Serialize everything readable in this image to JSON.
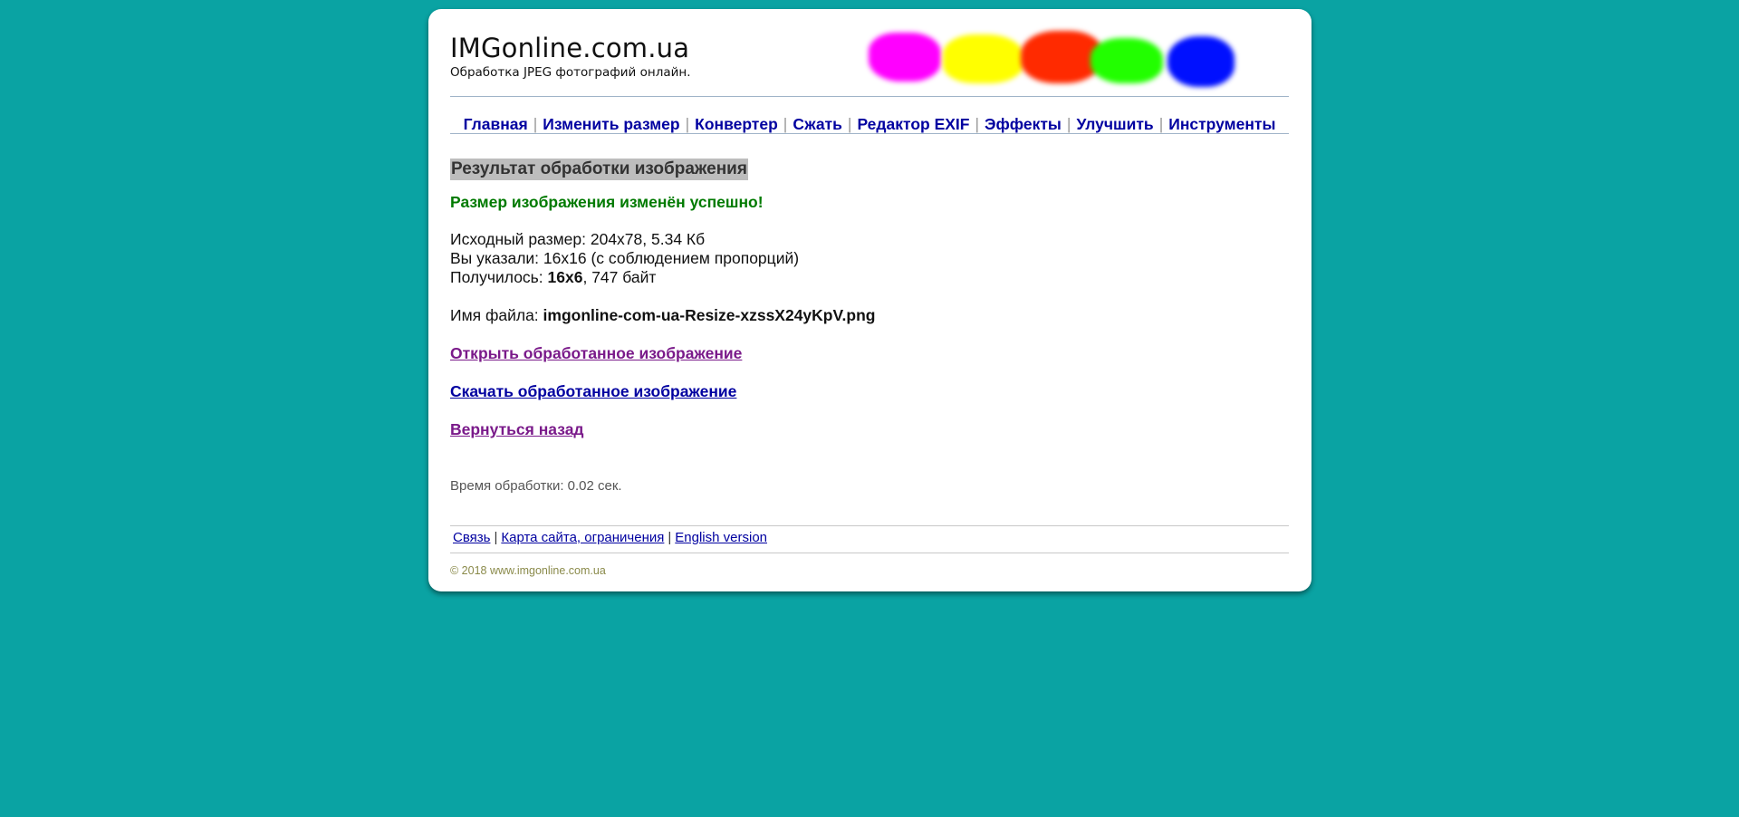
{
  "header": {
    "site_title": "IMGonline.com.ua",
    "tagline": "Обработка JPEG фотографий онлайн."
  },
  "colors": {
    "background": "#0aa3a3",
    "nav_link": "#0000a0",
    "success": "#007a00",
    "visited_link": "#7a1a8a",
    "divider": "#a0b4c8",
    "blots": [
      "#ff00ff",
      "#ffff00",
      "#ff2a00",
      "#22ff00",
      "#0010ff"
    ]
  },
  "nav": {
    "items": [
      {
        "label": "Главная"
      },
      {
        "label": "Изменить размер"
      },
      {
        "label": "Конвертер"
      },
      {
        "label": "Сжать"
      },
      {
        "label": "Редактор EXIF"
      },
      {
        "label": "Эффекты"
      },
      {
        "label": "Улучшить"
      },
      {
        "label": "Инструменты"
      }
    ],
    "separator": "|"
  },
  "result": {
    "heading": "Результат обработки изображения",
    "success_message": "Размер изображения изменён успешно!",
    "original_size_label": "Исходный размер:",
    "original_size_value": "204x78, 5.34 Кб",
    "specified_label": "Вы указали:",
    "specified_value": "16x16 (с соблюдением пропорций)",
    "result_label": "Получилось:",
    "result_dimensions": "16x6",
    "result_size": ", 747 байт",
    "filename_label": "Имя файла:",
    "filename_value": "imgonline-com-ua-Resize-xzssX24yKpV.png",
    "open_link": "Открыть обработанное изображение",
    "download_link": "Скачать обработанное изображение",
    "back_link": "Вернуться назад",
    "timing_text": "Время обработки: 0.02 сек."
  },
  "footer": {
    "links": [
      {
        "label": "Связь"
      },
      {
        "label": "Карта сайта, ограничения"
      },
      {
        "label": "English version"
      }
    ],
    "separator": "|",
    "copyright": "© 2018 www.imgonline.com.ua"
  }
}
